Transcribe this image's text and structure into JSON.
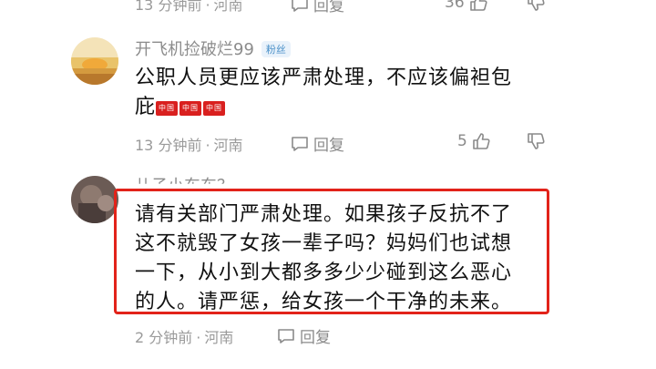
{
  "top_row": {
    "time": "13 分钟前",
    "location": "河南",
    "reply_label": "回复",
    "likes": "36"
  },
  "comments": [
    {
      "username": "开飞机捡破烂99",
      "badge": "粉丝",
      "text_line1": "公职人员更应该严肃处理，不应该偏袒包",
      "text_line2": "庇",
      "emoji": [
        "中国",
        "中国",
        "中国"
      ],
      "time": "13 分钟前",
      "location": "河南",
      "reply_label": "回复",
      "likes": "5"
    },
    {
      "username": "儿子小东东？",
      "text_lines": [
        "请有关部门严肃处理。如果孩子反抗不了",
        "这不就毁了女孩一辈子吗？妈妈们也试想",
        "一下，从小到大都多多少少碰到这么恶心",
        "的人。请严惩，给女孩一个干净的未来。"
      ],
      "time": "2 分钟前",
      "location": "河南",
      "reply_label": "回复"
    }
  ],
  "colors": {
    "highlight": "#e2231a",
    "meta": "#9a9a9a"
  }
}
